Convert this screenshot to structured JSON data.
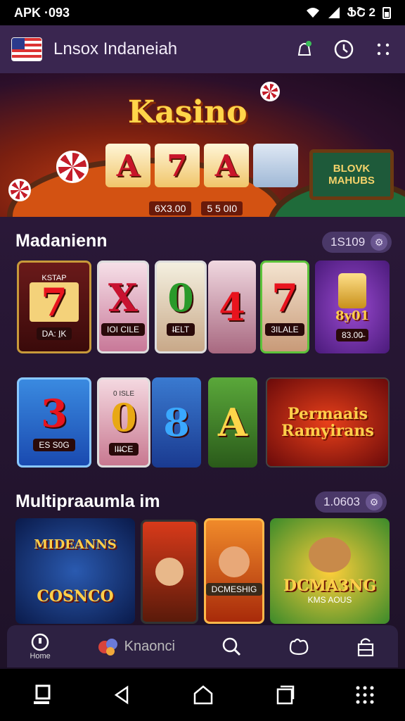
{
  "status_bar": {
    "left_text": "APK  ·093",
    "right_text": "ՖՇ 2"
  },
  "app_bar": {
    "title": "Lnsox Indaneiah"
  },
  "hero": {
    "logo": "Kasino",
    "sign_text": "BLOVK MAHUBS",
    "reels": [
      "A",
      "7",
      "A"
    ],
    "bets": [
      "6X3.00",
      "5 5 0I0"
    ]
  },
  "section1": {
    "title": "Madanienn",
    "badge": "1S109",
    "row1": [
      {
        "top": "KSTAP",
        "symbol": "7",
        "label": "DA: I̱K"
      },
      {
        "symbol": "X",
        "label": "IOI CILE"
      },
      {
        "symbol": "0",
        "label": "I̶ELT"
      },
      {
        "symbol": "4",
        "label": ""
      },
      {
        "symbol": "7",
        "label": "3ILALE"
      },
      {
        "symbol": "",
        "text": "8y01",
        "label": "83.00̶"
      }
    ],
    "row2": [
      {
        "symbol": "3",
        "label": "ES S0G"
      },
      {
        "top": "0 ISLE",
        "symbol": "0",
        "label": "II̶I̶CE"
      },
      {
        "symbol": "8",
        "label": ""
      },
      {
        "symbol": "A",
        "label": ""
      },
      {
        "text": "Permaais Ramyirans",
        "label": ""
      }
    ]
  },
  "section2": {
    "title": "Multipraaumla im",
    "badge": "1.0603",
    "tiles": [
      {
        "text_top": "MIDEANNS",
        "text_bottom": "COSNCO"
      },
      {
        "text": ""
      },
      {
        "text": "DCMESHIG"
      },
      {
        "text_top": "DCMA3NG",
        "text_bottom": "KMS AOUS"
      }
    ]
  },
  "bottom_nav": [
    {
      "label": "Home",
      "icon": "home-icon"
    },
    {
      "label": "Knaonci",
      "icon": "games-icon"
    },
    {
      "label": "",
      "icon": "search-icon"
    },
    {
      "label": "",
      "icon": "gift-icon"
    },
    {
      "label": "",
      "icon": "lock-icon"
    }
  ],
  "colors": {
    "app_bar": "#3a2650",
    "accent_gold": "#ffd54a",
    "accent_red": "#c8152a"
  }
}
